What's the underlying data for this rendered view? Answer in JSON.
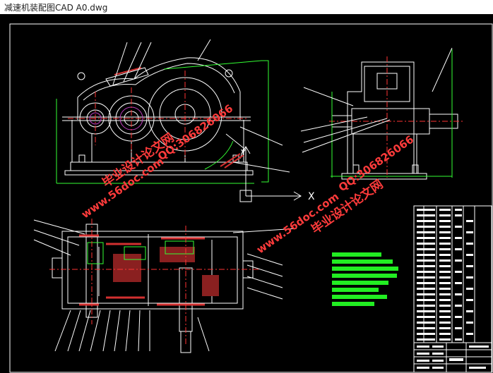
{
  "window": {
    "title": "减速机装配图CAD A0.dwg"
  },
  "watermarks": {
    "site_a": "www.56doc.com",
    "qq_a": "QQ:306826066",
    "thesis_a": "毕业设计论文网",
    "site_b": "www.56doc.com",
    "qq_b": "QQ:306826066",
    "thesis_b": "毕业设计论文网"
  },
  "ucs": {
    "x_label": "X",
    "y_label": "Y"
  },
  "colors": {
    "background": "#000000",
    "drawing_line": "#ffffff",
    "centerline": "#ff3333",
    "dimension": "#33ff33",
    "hatch": "#d23030",
    "watermark": "#ff3b3b",
    "notes_bar": "#22ee22"
  },
  "icons": {
    "ucs": "ucs-axis-icon"
  }
}
